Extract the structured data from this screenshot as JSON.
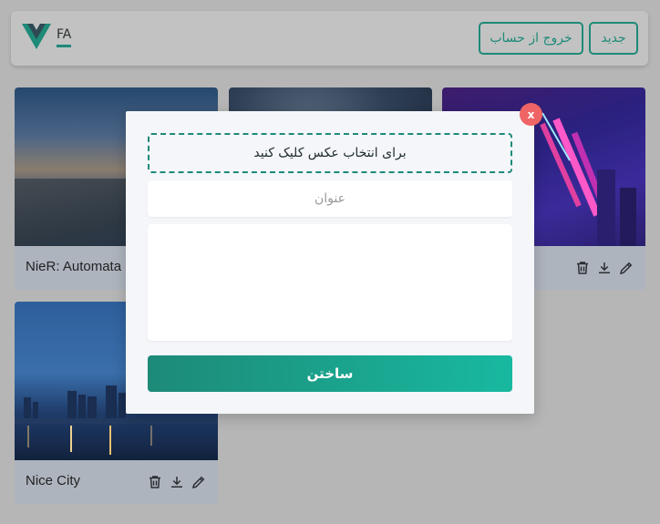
{
  "header": {
    "lang_label": "FA",
    "new_label": "جدید",
    "logout_label": "خروج از حساب"
  },
  "cards": [
    {
      "title": "NieR: Automata"
    },
    {
      "title": ""
    },
    {
      "title": ""
    },
    {
      "title": "Nice City"
    }
  ],
  "modal": {
    "pick_label": "برای انتخاب عکس کلیک کنید",
    "title_placeholder": "عنوان",
    "description_value": "",
    "submit_label": "ساختن",
    "close_label": "x"
  },
  "icons": {
    "logo": "vue-logo-icon",
    "delete": "trash-icon",
    "download": "download-icon",
    "edit": "pencil-icon"
  },
  "colors": {
    "accent": "#1e8a78",
    "close": "#ef6565",
    "backdrop": "#b6b6b6"
  }
}
